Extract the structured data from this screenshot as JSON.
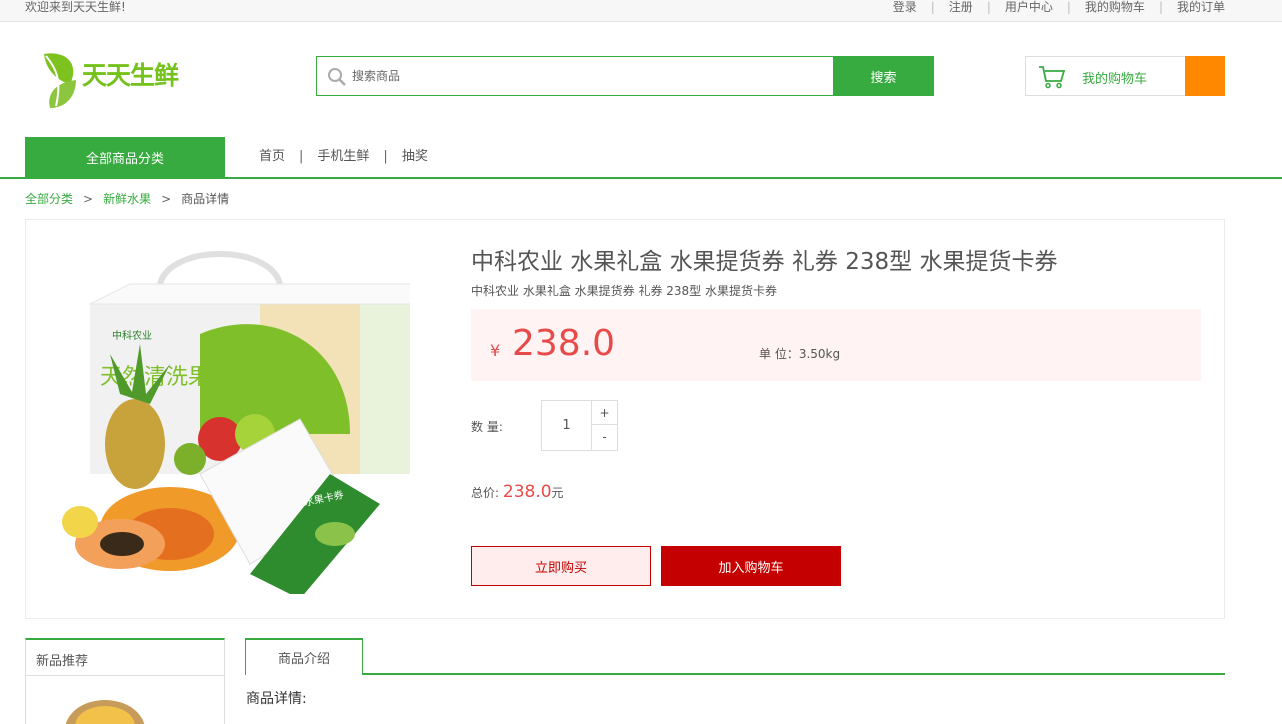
{
  "topbar": {
    "welcome": "欢迎来到天天生鲜!",
    "links": [
      "登录",
      "注册",
      "用户中心",
      "我的购物车",
      "我的订单"
    ]
  },
  "header": {
    "logo_text": "天天生鲜",
    "search_placeholder": "搜索商品",
    "search_button": "搜索",
    "cart_label": "我的购物车",
    "cart_count": ""
  },
  "nav": {
    "all_categories": "全部商品分类",
    "links": [
      "首页",
      "手机生鲜",
      "抽奖"
    ]
  },
  "breadcrumb": {
    "items": [
      "全部分类",
      "新鲜水果"
    ],
    "current": "商品详情"
  },
  "goods": {
    "title": "中科农业 水果礼盒 水果提货券 礼券 238型 水果提货卡券",
    "subtitle": "中科农业 水果礼盒 水果提货券 礼券 238型 水果提货卡券",
    "currency": "¥",
    "price": "238.0",
    "unit": "单 位：3.50kg",
    "qty_label": "数 量:",
    "qty": "1",
    "plus": "+",
    "minus": "-",
    "total_label": "总价:",
    "total_value": "238.0",
    "total_suffix": "元",
    "buy_now": "立即购买",
    "add_cart": "加入购物车",
    "box_brand": "中科农业",
    "box_slogan": "天然清洗果蔬",
    "card_text": "水果卡券"
  },
  "bottom": {
    "new_title": "新品推荐",
    "tab": "商品介绍",
    "detail_title": "商品详情:"
  },
  "colors": {
    "primary": "#37ab40",
    "price": "#e84a4a",
    "buy": "#c40000",
    "cart_accent": "#ff8800",
    "price_bg": "#fff3f3"
  }
}
